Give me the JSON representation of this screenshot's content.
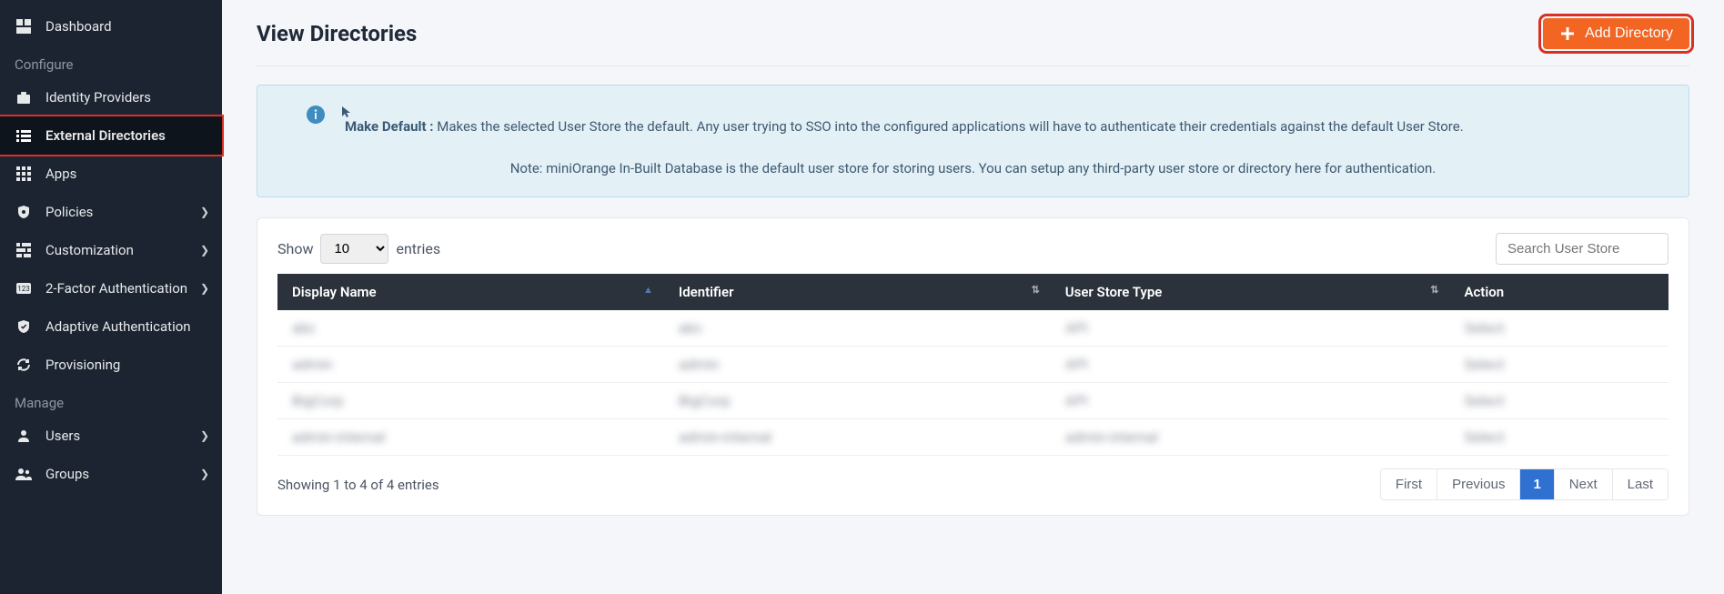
{
  "sidebar": {
    "top": [
      {
        "icon": "dashboard",
        "label": "Dashboard",
        "chev": false
      }
    ],
    "section_configure": "Configure",
    "configure": [
      {
        "icon": "briefcase",
        "label": "Identity Providers",
        "chev": false,
        "active": false
      },
      {
        "icon": "list",
        "label": "External Directories",
        "chev": false,
        "active": true
      },
      {
        "icon": "grid",
        "label": "Apps",
        "chev": false,
        "active": false
      },
      {
        "icon": "shield",
        "label": "Policies",
        "chev": true,
        "active": false
      },
      {
        "icon": "sliders",
        "label": "Customization",
        "chev": true,
        "active": false
      },
      {
        "icon": "numbers",
        "label": "2-Factor Authentication",
        "chev": true,
        "active": false
      },
      {
        "icon": "checkshield",
        "label": "Adaptive Authentication",
        "chev": false,
        "active": false
      },
      {
        "icon": "sync",
        "label": "Provisioning",
        "chev": false,
        "active": false
      }
    ],
    "section_manage": "Manage",
    "manage": [
      {
        "icon": "user",
        "label": "Users",
        "chev": true
      },
      {
        "icon": "groups",
        "label": "Groups",
        "chev": true
      }
    ]
  },
  "header": {
    "title": "View Directories",
    "add_button": "Add Directory"
  },
  "banner": {
    "lead": "Make Default :",
    "body": " Makes the selected User Store the default. Any user trying to SSO into the configured applications will have to authenticate their credentials against the default User Store.",
    "note": "Note: miniOrange In-Built Database is the default user store for storing users. You can setup any third-party user store or directory here for authentication."
  },
  "table": {
    "show_label": "Show",
    "entries_label": "entries",
    "page_size": "10",
    "search_placeholder": "Search User Store",
    "columns": [
      "Display Name",
      "Identifier",
      "User Store Type",
      "Action"
    ],
    "rows": [
      {
        "display_name": "abc",
        "identifier": "abc",
        "user_store_type": "API",
        "action": "Select"
      },
      {
        "display_name": "admin",
        "identifier": "admin",
        "user_store_type": "API",
        "action": "Select"
      },
      {
        "display_name": "BigCorp",
        "identifier": "BigCorp",
        "user_store_type": "API",
        "action": "Select"
      },
      {
        "display_name": "admin-internal",
        "identifier": "admin-internal",
        "user_store_type": "admin-internal",
        "action": "Select"
      }
    ],
    "info": "Showing 1 to 4 of 4 entries"
  },
  "pagination": {
    "first": "First",
    "previous": "Previous",
    "current": "1",
    "next": "Next",
    "last": "Last"
  }
}
